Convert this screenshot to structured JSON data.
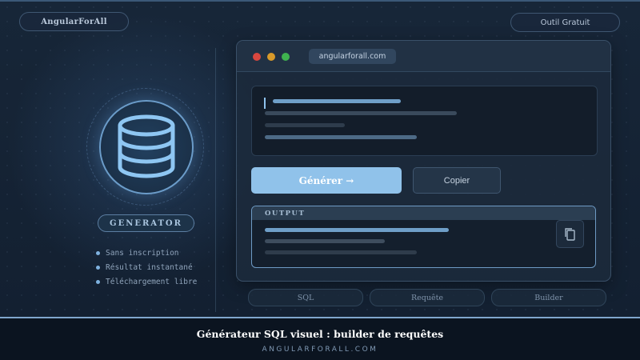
{
  "header": {
    "brand": "AngularForAll",
    "tool_badge": "Outil Gratuit"
  },
  "hero": {
    "badge": "GENERATOR",
    "features": [
      "Sans inscription",
      "Résultat instantané",
      "Téléchargement libre"
    ]
  },
  "browser": {
    "url": "angularforall.com",
    "generate_label": "Générer →",
    "copy_label": "Copier",
    "output_label": "OUTPUT"
  },
  "tabs": [
    "SQL",
    "Requête",
    "Builder"
  ],
  "footer": {
    "title": "Générateur SQL visuel : builder de requêtes",
    "site": "ANGULARFORALL.COM"
  },
  "colors": {
    "accent": "#90c2ea",
    "background": "#142133",
    "footer": "#0b1420",
    "dot_red": "#d9473f",
    "dot_yellow": "#d89a2a",
    "dot_green": "#3fb24f"
  },
  "icons": [
    "database-icon",
    "copy-icon"
  ]
}
